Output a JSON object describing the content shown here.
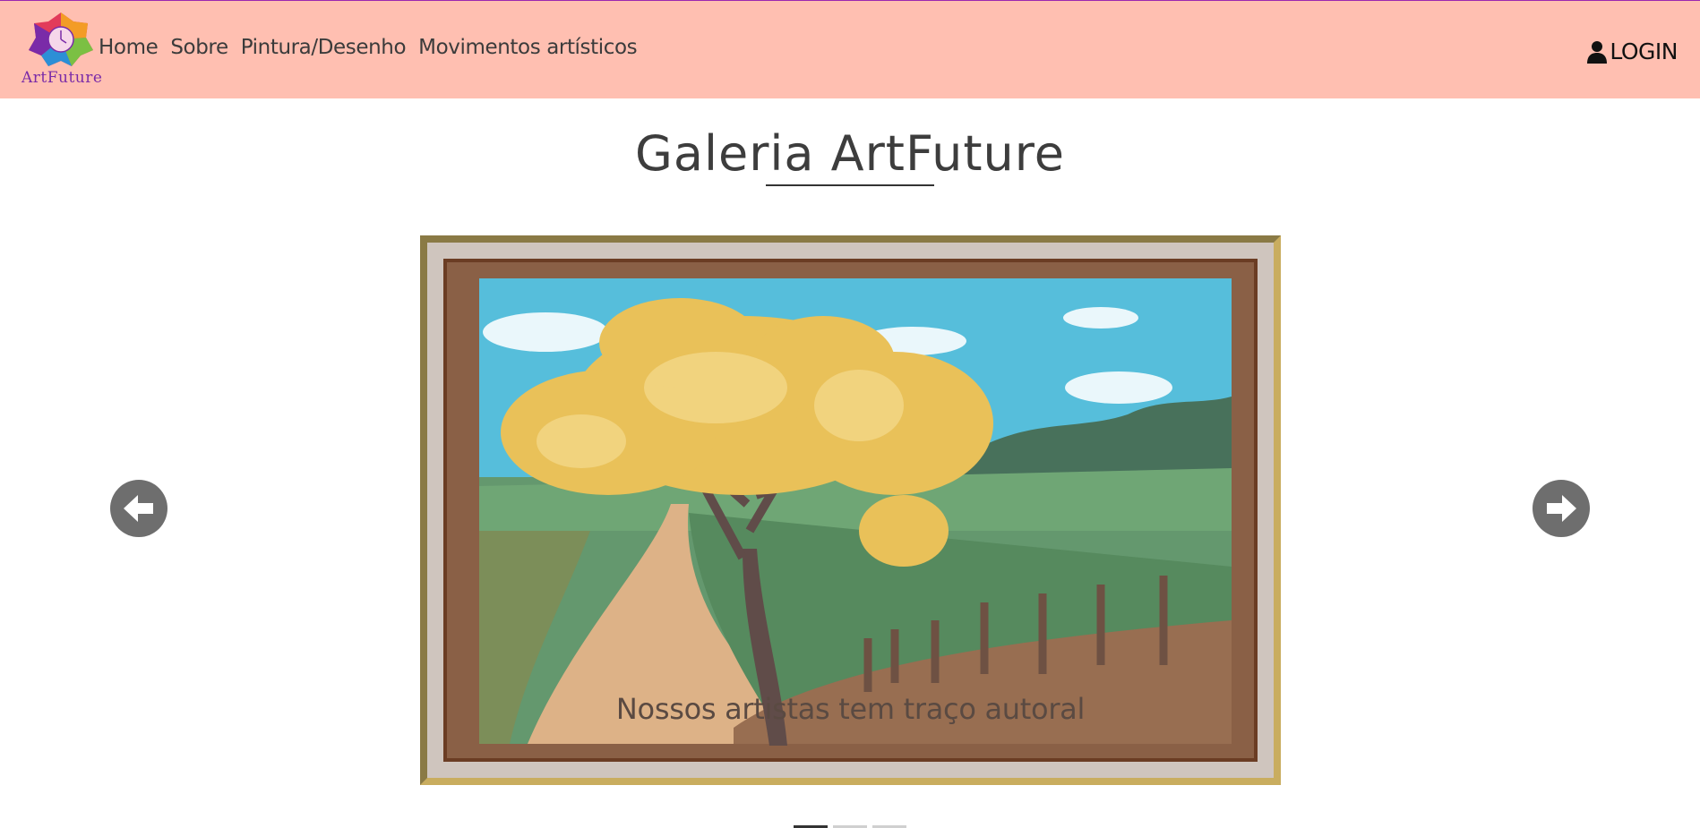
{
  "brand": {
    "name": "ArtFuture",
    "logo_icon": "flower-clock-logo-icon"
  },
  "nav": {
    "items": [
      {
        "label": "Home"
      },
      {
        "label": "Sobre"
      },
      {
        "label": "Pintura/Desenho"
      },
      {
        "label": "Movimentos artísticos"
      }
    ],
    "login_label": "LOGIN",
    "login_icon": "user-icon"
  },
  "gallery": {
    "title": "Galeria ArtFuture",
    "slide": {
      "caption": "Nossos artistas tem traço autoral"
    },
    "prev_icon": "arrow-left-icon",
    "next_icon": "arrow-right-icon",
    "indicators": {
      "count": 3,
      "active_index": 0
    }
  },
  "colors": {
    "navbar_bg": "#ffbfb1",
    "frame_gold": "#c9ad5f",
    "arrow_bg": "#6e6e6e"
  }
}
